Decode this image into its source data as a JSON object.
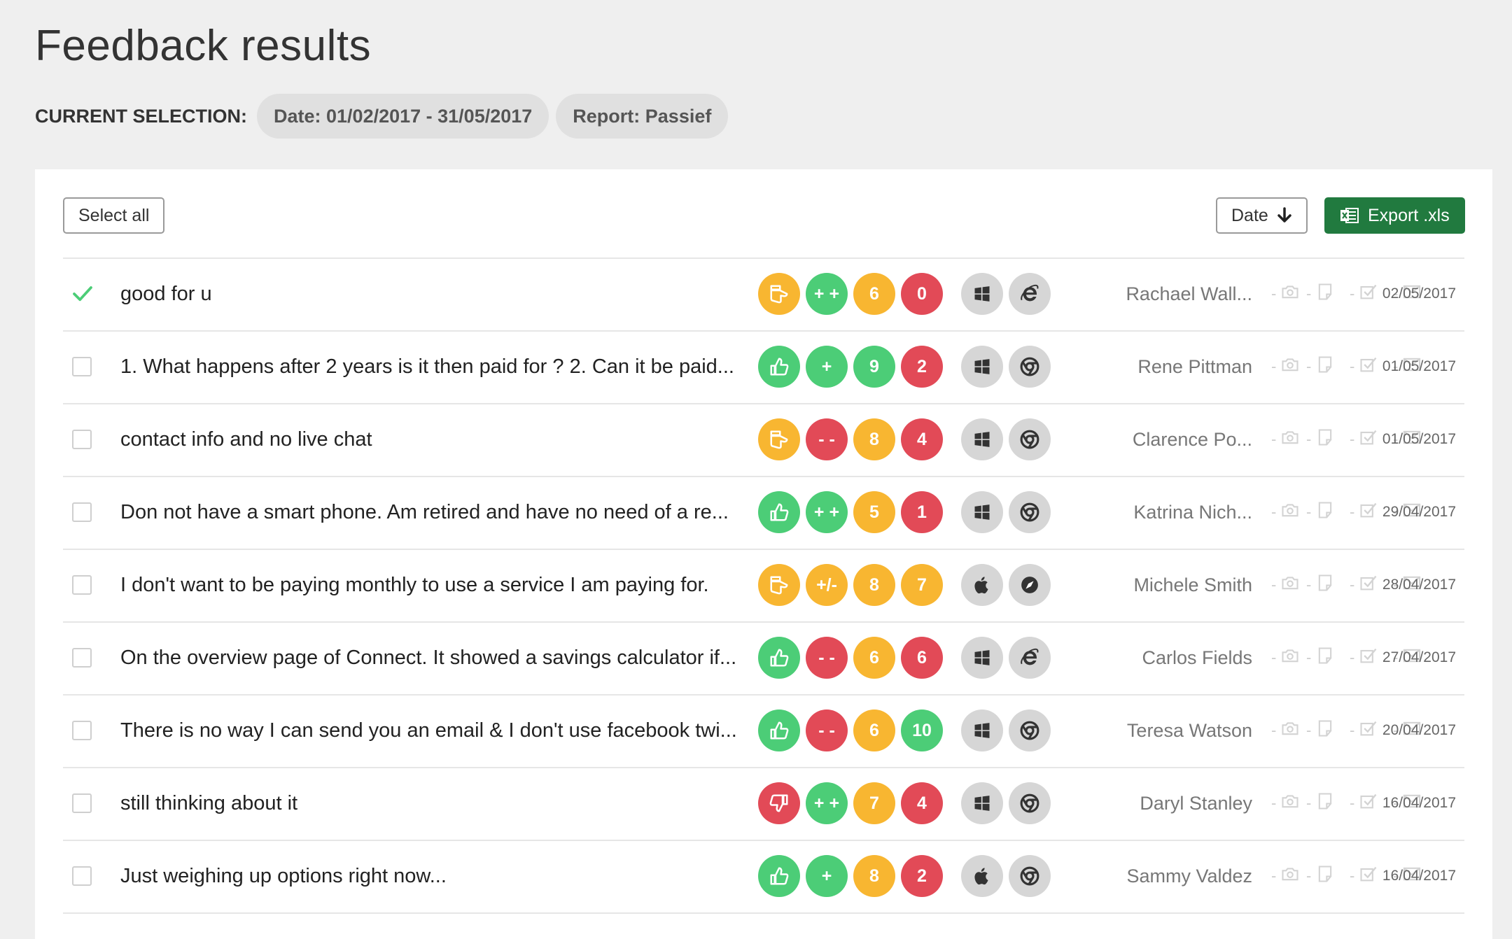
{
  "page": {
    "title": "Feedback results",
    "selection_label": "CURRENT SELECTION:",
    "chips": [
      "Date: 01/02/2017 - 31/05/2017",
      "Report: Passief"
    ]
  },
  "toolbar": {
    "select_all": "Select all",
    "sort_label": "Date",
    "export_label": "Export .xls"
  },
  "colors": {
    "yellow": "#f8b631",
    "green": "#4ccd77",
    "red": "#e24a57",
    "export_green": "#217a3f",
    "check_green": "#4ccd77"
  },
  "rows": [
    {
      "selected": true,
      "comment": "good for u",
      "thumb": "neutral",
      "thumb_color": "yellow",
      "rating": "+ +",
      "rating_color": "green",
      "score": "6",
      "score_color": "yellow",
      "count": "0",
      "count_color": "red",
      "os": "windows-icon",
      "browser": "ie-icon",
      "name": "Rachael Wall...",
      "date": "02/05/2017"
    },
    {
      "selected": false,
      "comment": "1. What happens after 2 years is it then paid for ? 2. Can it be paid...",
      "thumb": "up",
      "thumb_color": "green",
      "rating": "+",
      "rating_color": "green",
      "score": "9",
      "score_color": "green",
      "count": "2",
      "count_color": "red",
      "os": "windows-icon",
      "browser": "chrome-icon",
      "name": "Rene Pittman",
      "date": "01/05/2017"
    },
    {
      "selected": false,
      "comment": "contact info and no live chat",
      "thumb": "neutral",
      "thumb_color": "yellow",
      "rating": "- -",
      "rating_color": "red",
      "score": "8",
      "score_color": "yellow",
      "count": "4",
      "count_color": "red",
      "os": "windows-icon",
      "browser": "chrome-icon",
      "name": "Clarence Po...",
      "date": "01/05/2017"
    },
    {
      "selected": false,
      "comment": "Don not have a smart phone. Am retired and have no need of a re...",
      "thumb": "up",
      "thumb_color": "green",
      "rating": "+ +",
      "rating_color": "green",
      "score": "5",
      "score_color": "yellow",
      "count": "1",
      "count_color": "red",
      "os": "windows-icon",
      "browser": "chrome-icon",
      "name": "Katrina Nich...",
      "date": "29/04/2017"
    },
    {
      "selected": false,
      "comment": "I don't want to be paying monthly to use a service I am paying for.",
      "thumb": "neutral",
      "thumb_color": "yellow",
      "rating": "+/-",
      "rating_color": "yellow",
      "score": "8",
      "score_color": "yellow",
      "count": "7",
      "count_color": "yellow",
      "os": "apple-icon",
      "browser": "safari-icon",
      "name": "Michele Smith",
      "date": "28/04/2017"
    },
    {
      "selected": false,
      "comment": "On the overview page of Connect. It showed a savings calculator if...",
      "thumb": "up",
      "thumb_color": "green",
      "rating": "- -",
      "rating_color": "red",
      "score": "6",
      "score_color": "yellow",
      "count": "6",
      "count_color": "red",
      "os": "windows-icon",
      "browser": "ie-icon",
      "name": "Carlos Fields",
      "date": "27/04/2017"
    },
    {
      "selected": false,
      "comment": "There is no way I can send you an email & I don't use facebook twi...",
      "thumb": "up",
      "thumb_color": "green",
      "rating": "- -",
      "rating_color": "red",
      "score": "6",
      "score_color": "yellow",
      "count": "10",
      "count_color": "green",
      "os": "windows-icon",
      "browser": "chrome-icon",
      "name": "Teresa Watson",
      "date": "20/04/2017"
    },
    {
      "selected": false,
      "comment": "still thinking about it",
      "thumb": "down",
      "thumb_color": "red",
      "rating": "+ +",
      "rating_color": "green",
      "score": "7",
      "score_color": "yellow",
      "count": "4",
      "count_color": "red",
      "os": "windows-icon",
      "browser": "chrome-icon",
      "name": "Daryl Stanley",
      "date": "16/04/2017"
    },
    {
      "selected": false,
      "comment": "Just weighing up options right now...",
      "thumb": "up",
      "thumb_color": "green",
      "rating": "+",
      "rating_color": "green",
      "score": "8",
      "score_color": "yellow",
      "count": "2",
      "count_color": "red",
      "os": "apple-icon",
      "browser": "chrome-icon",
      "name": "Sammy Valdez",
      "date": "16/04/2017"
    }
  ],
  "status_icons": [
    "camera-icon",
    "note-icon",
    "checkbox-icon",
    "mail-icon"
  ]
}
